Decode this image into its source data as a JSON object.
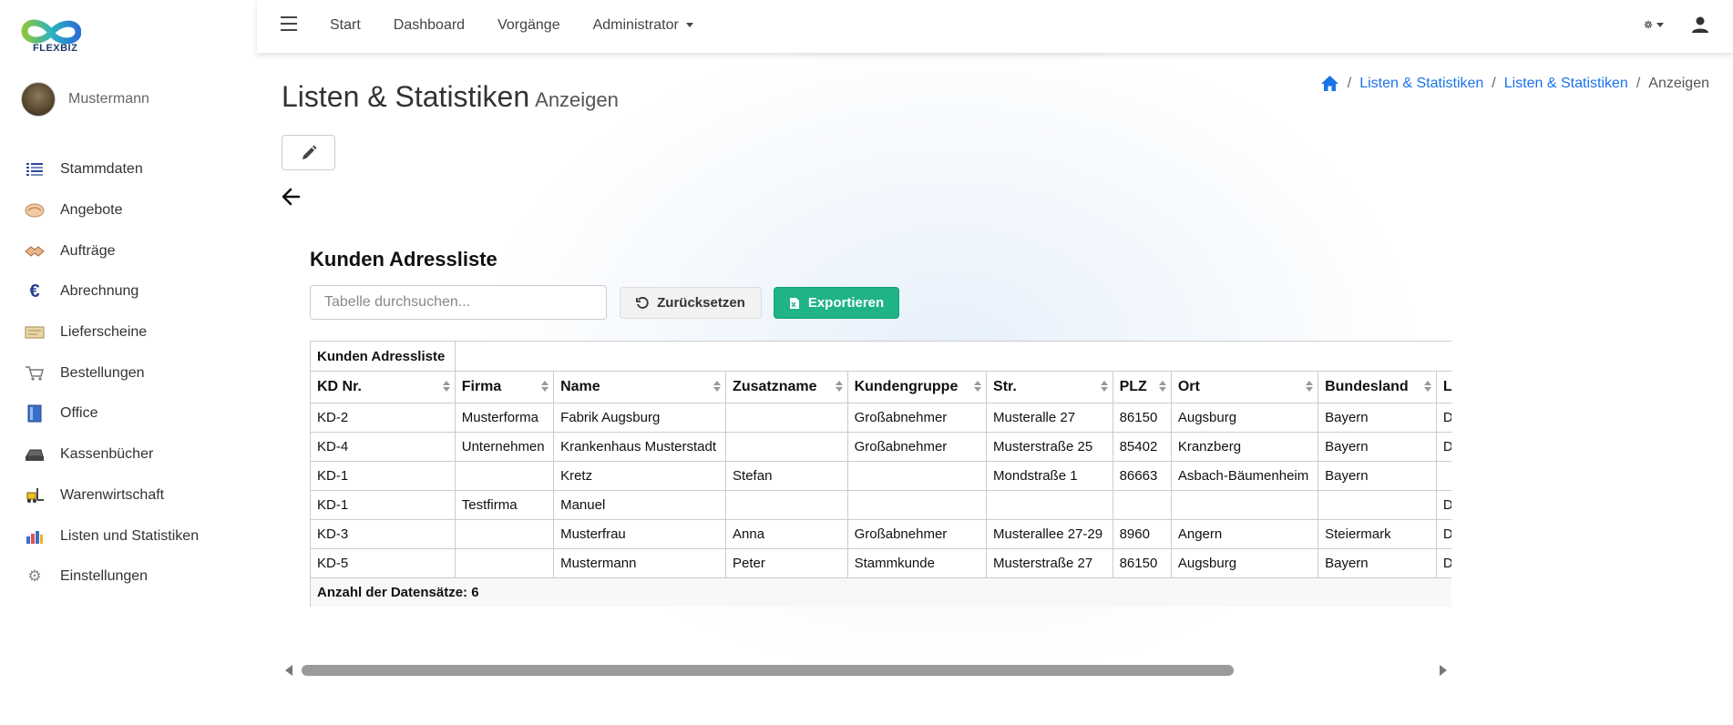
{
  "brand": {
    "name": "FLEXBIZ"
  },
  "user": {
    "name": "Mustermann"
  },
  "sidebar": {
    "items": [
      {
        "label": "Stammdaten",
        "icon": "list-icon"
      },
      {
        "label": "Angebote",
        "icon": "handshake-icon"
      },
      {
        "label": "Aufträge",
        "icon": "deal-icon"
      },
      {
        "label": "Abrechnung",
        "icon": "euro-icon"
      },
      {
        "label": "Lieferscheine",
        "icon": "receipt-icon"
      },
      {
        "label": "Bestellungen",
        "icon": "cart-icon"
      },
      {
        "label": "Office",
        "icon": "book-icon"
      },
      {
        "label": "Kassenbücher",
        "icon": "register-icon"
      },
      {
        "label": "Warenwirtschaft",
        "icon": "forklift-icon"
      },
      {
        "label": "Listen und Statistiken",
        "icon": "bar-chart-icon"
      },
      {
        "label": "Einstellungen",
        "icon": "gear-icon"
      }
    ]
  },
  "topnav": {
    "items": [
      "Start",
      "Dashboard",
      "Vorgänge",
      "Administrator"
    ]
  },
  "page": {
    "title": "Listen & Statistiken",
    "subtitle": "Anzeigen"
  },
  "breadcrumb": {
    "items": [
      "Listen & Statistiken",
      "Listen & Statistiken"
    ],
    "current": "Anzeigen"
  },
  "report": {
    "title": "Kunden Adressliste",
    "search_placeholder": "Tabelle durchsuchen...",
    "reset_label": "Zurücksetzen",
    "export_label": "Exportieren"
  },
  "table": {
    "caption": "Kunden Adressliste",
    "columns": [
      "KD Nr.",
      "Firma",
      "Name",
      "Zusatzname",
      "Kundengruppe",
      "Str.",
      "PLZ",
      "Ort",
      "Bundesland",
      "Land"
    ],
    "rows": [
      [
        "KD-2",
        "Musterforma",
        "Fabrik Augsburg",
        "",
        "Großabnehmer",
        "Musteralle 27",
        "86150",
        "Augsburg",
        "Bayern",
        "DE"
      ],
      [
        "KD-4",
        "Unternehmen",
        "Krankenhaus Musterstadt",
        "",
        "Großabnehmer",
        "Musterstraße 25",
        "85402",
        "Kranzberg",
        "Bayern",
        "DE"
      ],
      [
        "KD-1",
        "",
        "Kretz",
        "Stefan",
        "",
        "Mondstraße 1",
        "86663",
        "Asbach-Bäumenheim",
        "Bayern",
        ""
      ],
      [
        "KD-1",
        "Testfirma",
        "Manuel",
        "",
        "",
        "",
        "",
        "",
        "",
        "DE"
      ],
      [
        "KD-3",
        "",
        "Musterfrau",
        "Anna",
        "Großabnehmer",
        "Musterallee 27-29",
        "8960",
        "Angern",
        "Steiermark",
        "DE"
      ],
      [
        "KD-5",
        "",
        "Mustermann",
        "Peter",
        "Stammkunde",
        "Musterstraße 27",
        "86150",
        "Augsburg",
        "Bayern",
        "DE"
      ]
    ],
    "footer": "Anzahl der Datensätze: 6"
  },
  "colors": {
    "accent": "#1a73e8",
    "export": "#1fb386"
  }
}
